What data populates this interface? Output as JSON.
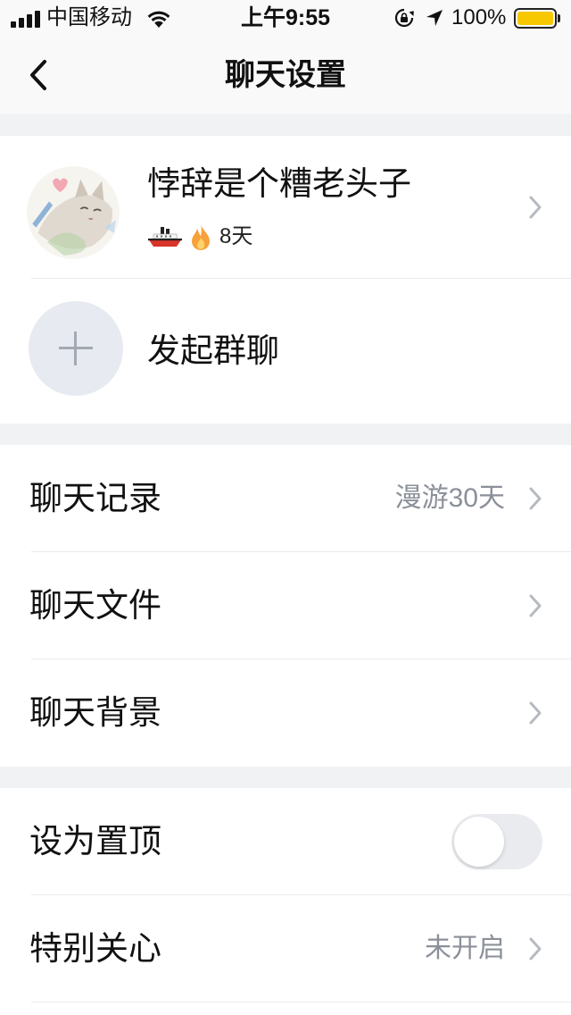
{
  "status_bar": {
    "carrier": "中国移动",
    "time": "上午9:55",
    "battery_text": "100%",
    "battery_level": 1.0,
    "signal_strength": 4,
    "signal_max": 4,
    "icons": {
      "signal": "signal-bars-icon",
      "wifi": "wifi-icon",
      "rotation_lock": "rotation-lock-icon",
      "location": "location-arrow-icon",
      "battery": "battery-icon"
    }
  },
  "nav": {
    "title": "聊天设置",
    "back_icon": "chevron-left-icon"
  },
  "profile": {
    "name": "悖辞是个糟老头子",
    "avatar_icon": "cat-avatar-icon",
    "badge_icons": [
      "ship-icon",
      "flame-icon"
    ],
    "streak": "8天",
    "chevron_icon": "chevron-right-icon"
  },
  "group_chat": {
    "label": "发起群聊",
    "icon": "plus-icon"
  },
  "settings": [
    {
      "rows": [
        {
          "label": "聊天记录",
          "value": "漫游30天",
          "icon": "chevron-right-icon"
        },
        {
          "label": "聊天文件",
          "icon": "chevron-right-icon"
        },
        {
          "label": "聊天背景",
          "icon": "chevron-right-icon"
        }
      ]
    },
    {
      "rows": [
        {
          "label": "设为置顶",
          "toggle_on": false
        },
        {
          "label": "特别关心",
          "value": "未开启",
          "icon": "chevron-right-icon"
        }
      ]
    }
  ],
  "colors": {
    "page_background": "#f1f2f4",
    "row_background": "#ffffff",
    "text_primary": "#111111",
    "text_secondary": "#8b9099",
    "chevron": "#b6bac1",
    "battery_fill": "#f7c800",
    "toggle_off_track": "#e9ebef",
    "plus_circle": "#e7eaf0"
  }
}
